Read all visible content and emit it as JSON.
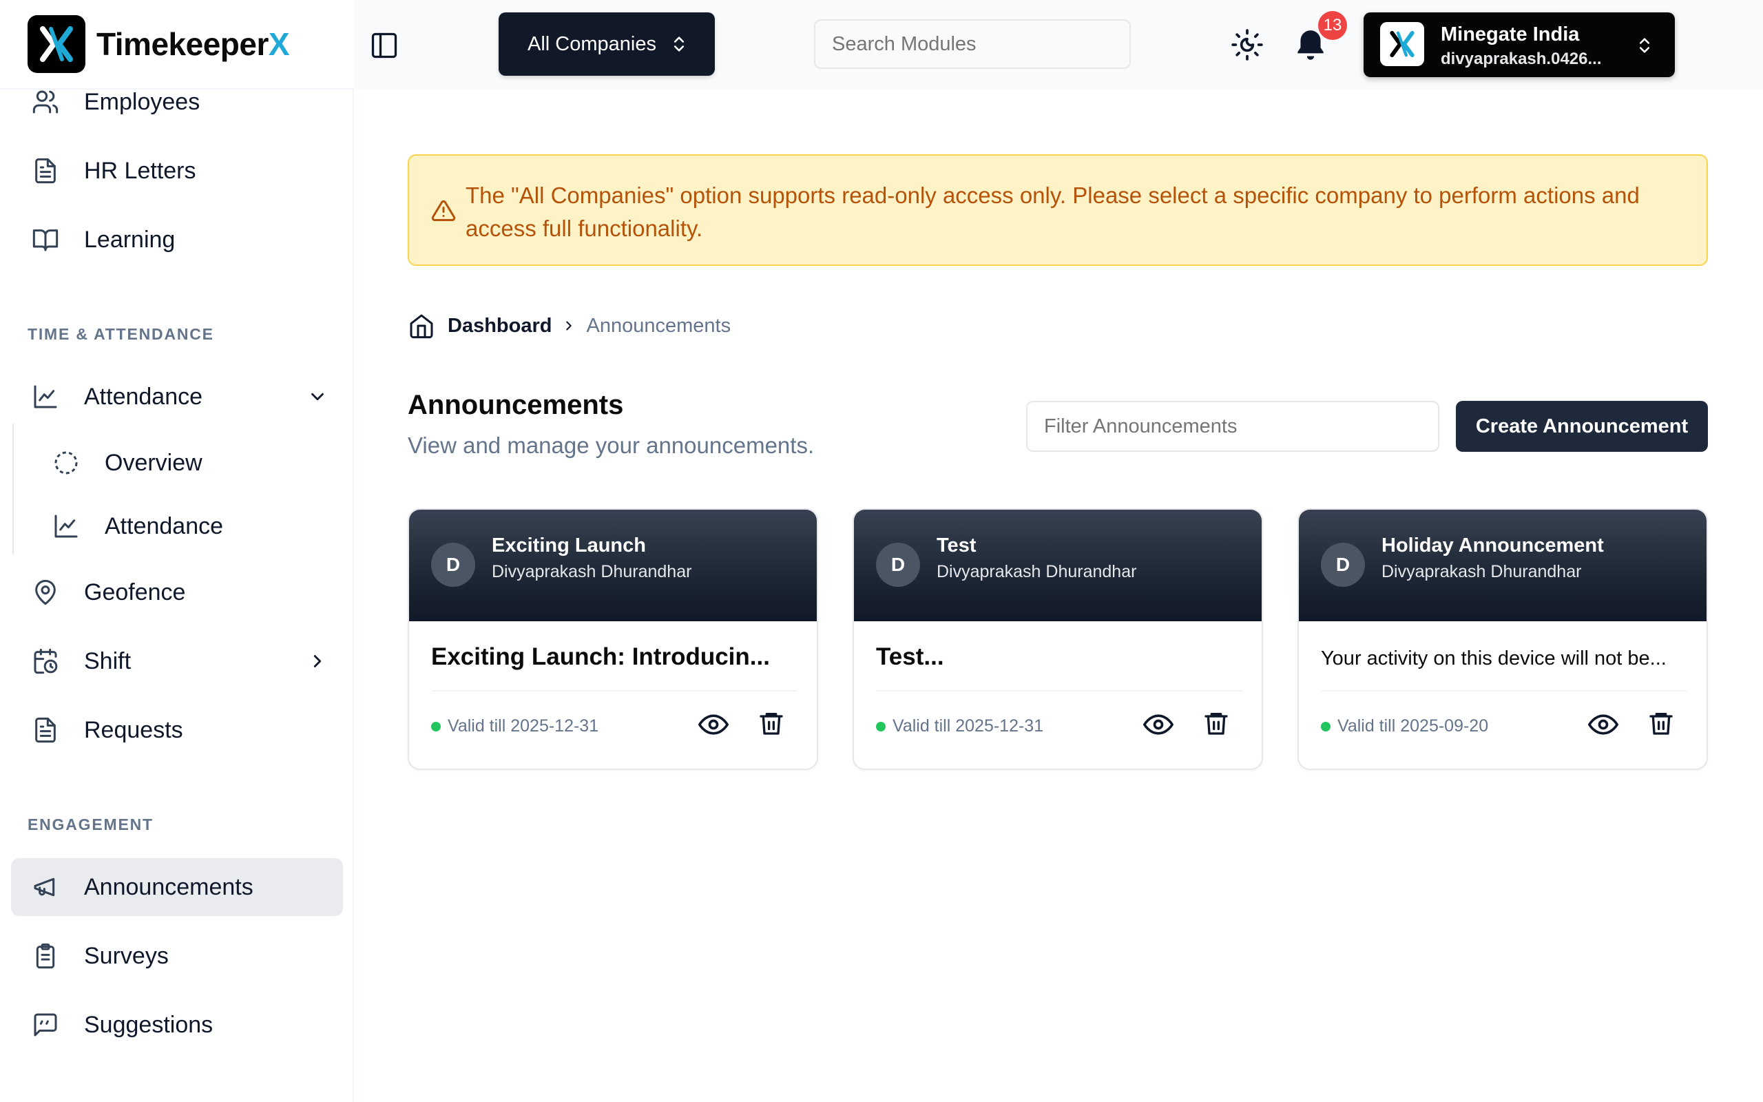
{
  "app": {
    "brand_main": "Timekeeper",
    "brand_accent": "X"
  },
  "colors": {
    "brand_accent": "#1fa9d6",
    "alert_bg": "#fef3c7",
    "alert_text": "#b45309",
    "primary_dark": "#1e293b",
    "valid_dot": "#22c55e",
    "badge": "#ef4444"
  },
  "sidebar": {
    "items": [
      {
        "label": "Employees",
        "icon": "users-icon"
      },
      {
        "label": "HR Letters",
        "icon": "document-icon"
      },
      {
        "label": "Learning",
        "icon": "book-icon"
      }
    ],
    "sections": {
      "time": "TIME & ATTENDANCE",
      "engagement": "ENGAGEMENT"
    },
    "time_items": [
      {
        "label": "Attendance",
        "icon": "chart-line-icon"
      },
      {
        "label": "Overview",
        "icon": "dashed-circle-icon"
      },
      {
        "label": "Attendance",
        "icon": "chart-line-icon"
      },
      {
        "label": "Geofence",
        "icon": "map-pin-icon"
      },
      {
        "label": "Shift",
        "icon": "calendar-clock-icon"
      },
      {
        "label": "Requests",
        "icon": "document-icon"
      }
    ],
    "engagement_items": [
      {
        "label": "Announcements",
        "icon": "megaphone-icon"
      },
      {
        "label": "Surveys",
        "icon": "clipboard-icon"
      },
      {
        "label": "Suggestions",
        "icon": "message-icon"
      }
    ]
  },
  "topbar": {
    "company_select": "All Companies",
    "search_placeholder": "Search Modules",
    "notification_count": "13",
    "account_name": "Minegate India",
    "account_email": "divyaprakash.0426..."
  },
  "alert": {
    "message": "The \"All Companies\" option supports read-only access only. Please select a specific company to perform actions and access full functionality."
  },
  "breadcrumb": {
    "root": "Dashboard",
    "current": "Announcements"
  },
  "page": {
    "title": "Announcements",
    "subtitle": "View and manage your announcements.",
    "filter_placeholder": "Filter Announcements",
    "create_label": "Create Announcement"
  },
  "cards": [
    {
      "initial": "D",
      "title": "Exciting Launch",
      "author": "Divyaprakash Dhurandhar",
      "body": "Exciting Launch: Introducin...",
      "valid": "Valid till 2025-12-31"
    },
    {
      "initial": "D",
      "title": "Test",
      "author": "Divyaprakash Dhurandhar",
      "body": "Test...",
      "valid": "Valid till 2025-12-31"
    },
    {
      "initial": "D",
      "title": "Holiday Announcement",
      "author": "Divyaprakash Dhurandhar",
      "body": "Your activity on this device will not be...",
      "valid": "Valid till 2025-09-20"
    }
  ]
}
